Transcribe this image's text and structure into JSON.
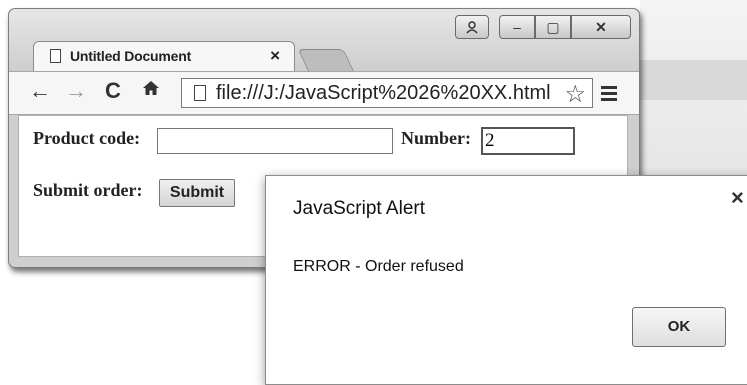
{
  "browser": {
    "tab_title": "Untitled Document",
    "tab_close": "×",
    "window_buttons": {
      "minimize": "–",
      "maximize": "▢",
      "close": "✕"
    },
    "address": "file:///J:/JavaScript%2026%20XX.html",
    "icons": [
      "profile-icon",
      "back-icon",
      "forward-icon",
      "reload-icon",
      "home-icon",
      "page-icon",
      "star-icon",
      "menu-icon"
    ]
  },
  "page": {
    "product_label": "Product code:",
    "product_value": "",
    "number_label": "Number:",
    "number_value": "2",
    "submit_label": "Submit order:",
    "submit_button": "Submit"
  },
  "alert": {
    "title": "JavaScript Alert",
    "message": "ERROR - Order refused",
    "ok": "OK",
    "close": "×"
  }
}
